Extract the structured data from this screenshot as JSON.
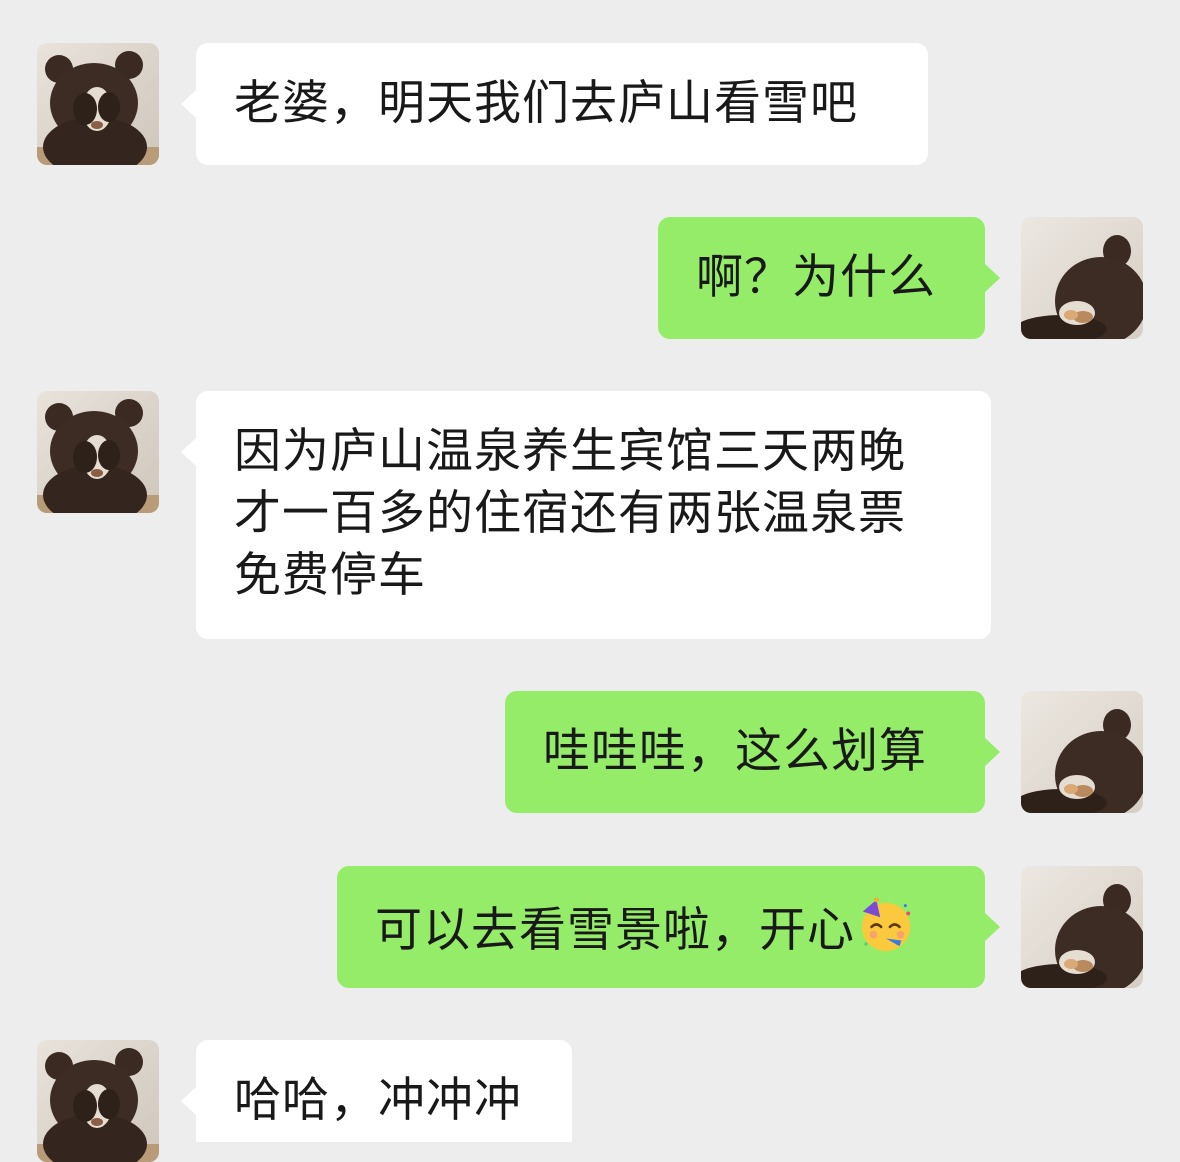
{
  "conversation": {
    "messages": [
      {
        "sender": "contact",
        "text": "老婆，明天我们去庐山看雪吧"
      },
      {
        "sender": "me",
        "text": "啊？为什么"
      },
      {
        "sender": "contact",
        "text": "因为庐山温泉养生宾馆三天两晚\n才一百多的住宿还有两张温泉票\n免费停车"
      },
      {
        "sender": "me",
        "text": "哇哇哇，这么划算"
      },
      {
        "sender": "me",
        "text": "可以去看雪景啦，开心",
        "emoji": "partying-face-emoji"
      },
      {
        "sender": "contact",
        "text": "哈哈，冲冲冲"
      }
    ]
  },
  "colors": {
    "background": "#ededed",
    "incoming_bubble": "#ffffff",
    "outgoing_bubble": "#95ec69",
    "text": "#191919"
  },
  "icons": {
    "contact_avatar": "bear-covering-face-avatar",
    "my_avatar": "bear-lying-down-avatar"
  }
}
